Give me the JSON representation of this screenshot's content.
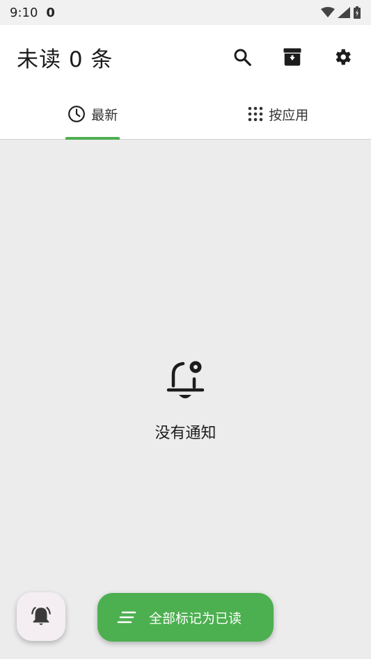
{
  "status_bar": {
    "time": "9:10",
    "extra": "0"
  },
  "appbar": {
    "title": "未读 0 条"
  },
  "tabs": [
    {
      "label": "最新",
      "icon": "clock-icon",
      "selected": true
    },
    {
      "label": "按应用",
      "icon": "grid-icon",
      "selected": false
    }
  ],
  "empty_state": {
    "message": "没有通知",
    "icon": "bell-settings-icon"
  },
  "fab": {
    "mark_all_read_label": "全部标记为已读"
  },
  "colors": {
    "accent": "#4caf50",
    "background": "#ececec",
    "surface": "#ffffff"
  }
}
